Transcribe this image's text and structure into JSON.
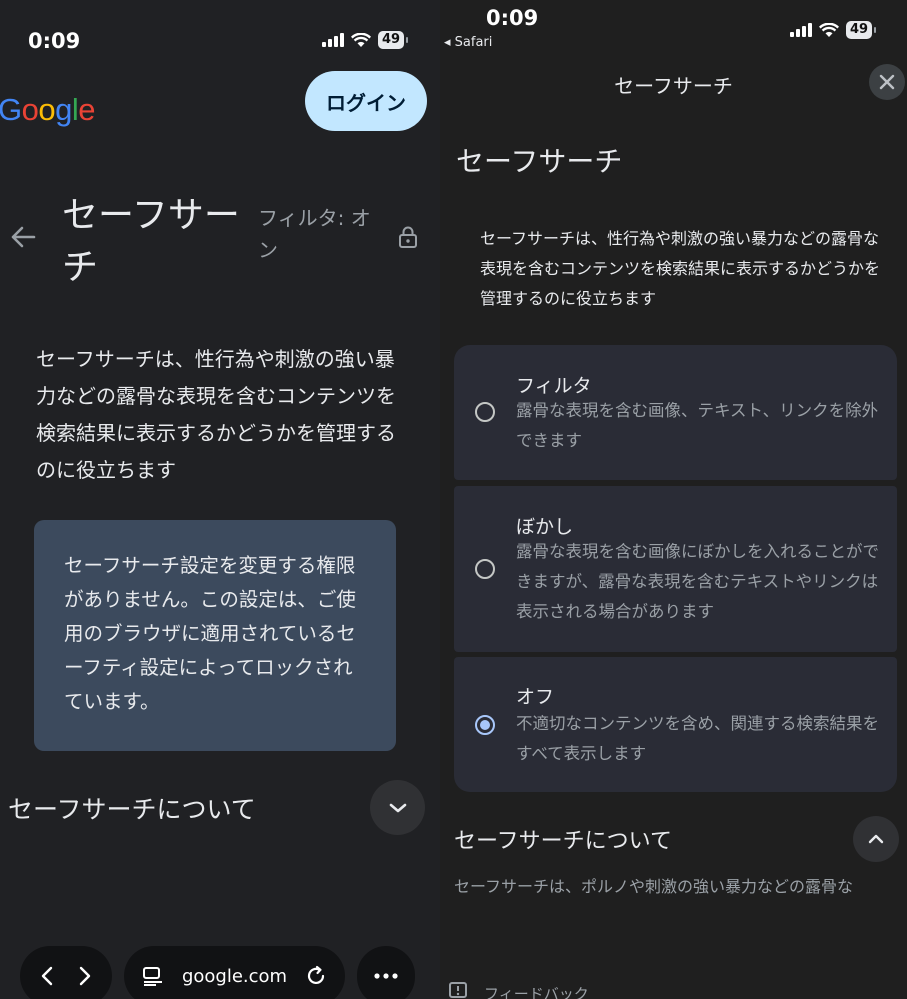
{
  "left": {
    "status": {
      "time": "0:09",
      "battery": "49"
    },
    "logo": [
      {
        "char": "G",
        "color": "#4285f4"
      },
      {
        "char": "o",
        "color": "#ea4335"
      },
      {
        "char": "o",
        "color": "#fbbc05"
      },
      {
        "char": "g",
        "color": "#4285f4"
      },
      {
        "char": "l",
        "color": "#34a853"
      },
      {
        "char": "e",
        "color": "#ea4335"
      }
    ],
    "login_label": "ログイン",
    "page_title": "セーフサーチ",
    "filter_status": "フィルタ: オン",
    "description": "セーフサーチは、性行為や刺激の強い暴力などの露骨な表現を含むコンテンツを検索結果に表示するかどうかを管理するのに役立ちます",
    "notice": "セーフサーチ設定を変更する権限がありません。この設定は、ご使用のブラウザに適用されているセーフティ設定によってロックされています。",
    "about_title": "セーフサーチについて",
    "url": "google.com"
  },
  "right": {
    "status": {
      "time": "0:09",
      "back_app": "◂ Safari",
      "battery": "49"
    },
    "header": "セーフサーチ",
    "page_title": "セーフサーチ",
    "description": "セーフサーチは、性行為や刺激の強い暴力などの露骨な表現を含むコンテンツを検索結果に表示するかどうかを管理するのに役立ちます",
    "options": [
      {
        "title": "フィルタ",
        "description": "露骨な表現を含む画像、テキスト、リンクを除外できます",
        "selected": false
      },
      {
        "title": "ぼかし",
        "description": "露骨な表現を含む画像にぼかしを入れることができますが、露骨な表現を含むテキストやリンクは表示される場合があります",
        "selected": false
      },
      {
        "title": "オフ",
        "description": "不適切なコンテンツを含め、関連する検索結果をすべて表示します",
        "selected": true
      }
    ],
    "about_title": "セーフサーチについて",
    "about_text": "セーフサーチは、ポルノや刺激の強い暴力などの露骨な",
    "feedback": "フィードバック"
  },
  "colors": {
    "login_bg": "#c2e7ff",
    "notice_bg": "#3c4a5d",
    "option_bg": "#2a2c36",
    "radio_selected": "#a8c7fa"
  }
}
